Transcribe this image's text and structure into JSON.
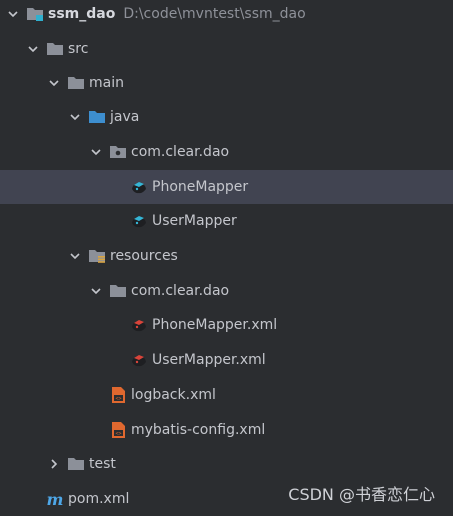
{
  "tree": {
    "root": {
      "name": "ssm_dao",
      "path": "D:\\code\\mvntest\\ssm_dao"
    },
    "src": "src",
    "main": "main",
    "java": "java",
    "package_java": "com.clear.dao",
    "file_phone_mapper": "PhoneMapper",
    "file_user_mapper": "UserMapper",
    "resources": "resources",
    "package_resources": "com.clear.dao",
    "file_phone_mapper_xml": "PhoneMapper.xml",
    "file_user_mapper_xml": "UserMapper.xml",
    "file_logback": "logback.xml",
    "file_mybatis_config": "mybatis-config.xml",
    "test": "test",
    "pom": "pom.xml"
  },
  "watermark": "CSDN @书香恋仁心",
  "colors": {
    "background": "#2b2d30",
    "selected_row": "#414451",
    "text": "#c4c6cc",
    "java_folder": "#3d8ecf",
    "xml_icon": "#e0682f"
  },
  "icons": {
    "chevron_expanded": "chevron-down-icon",
    "chevron_collapsed": "chevron-right-icon",
    "folder": "folder-icon",
    "module": "module-folder-icon",
    "source_root": "source-root-folder-icon",
    "package": "package-folder-icon",
    "resources_root": "resources-folder-icon",
    "mybatis_mapper": "mybatis-mapper-icon",
    "mybatis_xml": "mybatis-xml-icon",
    "xml_file": "xml-file-icon",
    "maven": "maven-m-icon"
  }
}
